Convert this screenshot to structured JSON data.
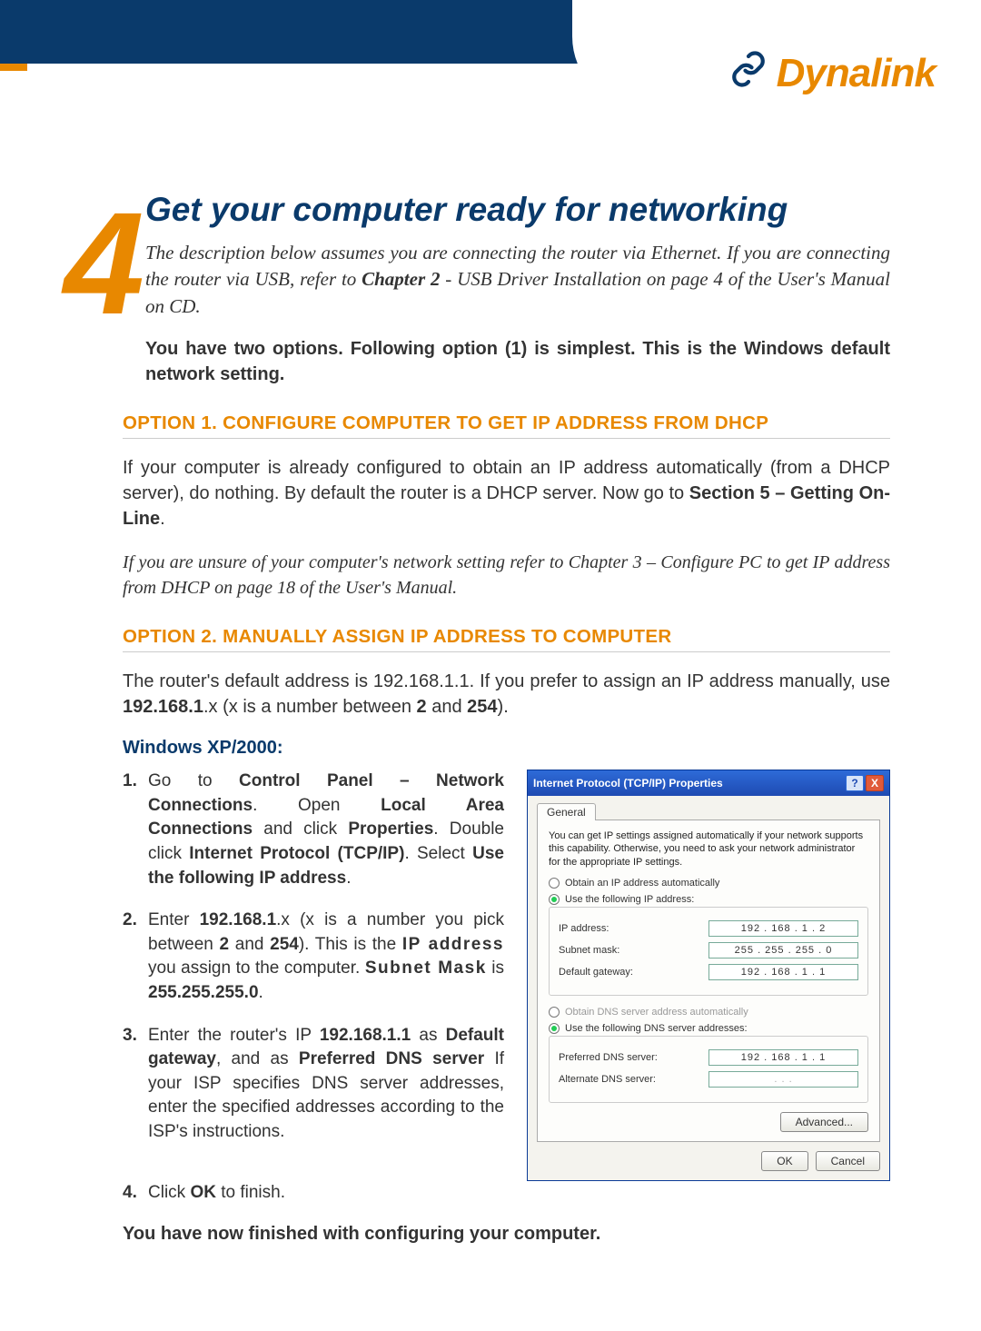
{
  "brand": {
    "name": "Dynalink"
  },
  "section": {
    "number": "4",
    "title": "Get your computer ready for networking",
    "intro_html": "The description below assumes you are connecting the router via Ethernet. If you are connecting the router via USB, refer to <b>Chapter 2</b> - USB Driver Installation on page 4 of the User's Manual on CD.",
    "options_note": "You have two options. Following option (1) is simplest. This is the Windows default network setting."
  },
  "option1": {
    "heading": "OPTION 1. CONFIGURE COMPUTER TO GET IP ADDRESS FROM DHCP",
    "para_html": "If your computer is already configured to obtain an IP address automatically (from a DHCP server), do nothing. By default the router is a DHCP server. Now go to <b>Section 5 – Getting On-Line</b>.",
    "italic_note": "If you are unsure of your computer's network setting refer to Chapter 3 – Configure PC to get IP address from DHCP on page 18 of the User's Manual."
  },
  "option2": {
    "heading": "OPTION 2. MANUALLY ASSIGN IP ADDRESS TO COMPUTER",
    "para_html": "The router's default address is 192.168.1.1. If you prefer to assign an IP address manually, use <b>192.168.1</b>.x (x is a number between <b>2</b> and <b>254</b>).",
    "sub_heading": "Windows XP/2000:",
    "steps": [
      "Go to <b>Control Panel – Network Connections</b>. Open <b>Local Area Connections</b> and click <b>Properties</b>. Double click <b>Internet Protocol (TCP/IP)</b>. Select <b>Use the following IP address</b>.",
      "Enter <b>192.168.1</b>.x (x is a number you pick between <b>2</b> and <b>254</b>). This is the <b class=\"spaced\">IP address</b> you assign to the computer. <b class=\"spaced\">Subnet Mask</b> is <b>255.255.255.0</b>.",
      "Enter the router's IP <b>192.168.1.1</b> as <b>Default gateway</b>, and as <b>Preferred DNS server</b> If your ISP specifies DNS server addresses, enter the specified addresses according to the ISP's instructions.",
      "Click <b>OK</b> to finish."
    ],
    "closing": "You have now finished with configuring your computer."
  },
  "dialog": {
    "title": "Internet Protocol (TCP/IP) Properties",
    "tab": "General",
    "desc": "You can get IP settings assigned automatically if your network supports this capability. Otherwise, you need to ask your network administrator for the appropriate IP settings.",
    "radio_auto_ip": "Obtain an IP address automatically",
    "radio_use_ip": "Use the following IP address:",
    "ip_label": "IP address:",
    "ip_value": "192 . 168 .  1  .  2",
    "mask_label": "Subnet mask:",
    "mask_value": "255 . 255 . 255 .  0",
    "gw_label": "Default gateway:",
    "gw_value": "192 . 168 .  1  .  1",
    "radio_auto_dns": "Obtain DNS server address automatically",
    "radio_use_dns": "Use the following DNS server addresses:",
    "pref_dns_label": "Preferred DNS server:",
    "pref_dns_value": "192 . 168 .  1  .  1",
    "alt_dns_label": "Alternate DNS server:",
    "alt_dns_value": " .     .     . ",
    "advanced": "Advanced...",
    "ok": "OK",
    "cancel": "Cancel"
  }
}
